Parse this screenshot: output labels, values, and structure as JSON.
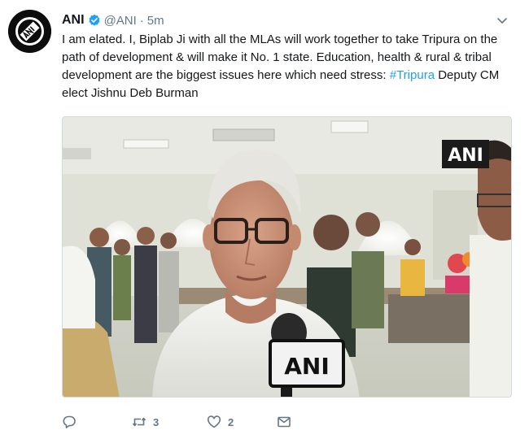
{
  "tweet": {
    "author_name": "ANI",
    "handle": "@ANI",
    "separator": "·",
    "time": "5m",
    "text_before": "I am elated. I, Biplab Ji with all the MLAs will work together to take Tripura on the path of development & will make it No. 1 state. Education, health & rural & tribal development are the biggest issues here which need stress: ",
    "hashtag": "#Tripura",
    "text_after": " Deputy CM elect Jishnu Deb Burman"
  },
  "media": {
    "watermark": "ANI",
    "mic_label": "ANI"
  },
  "actions": {
    "reply_count": "",
    "retweet_count": "3",
    "like_count": "2"
  },
  "colors": {
    "accent": "#1da1f2",
    "secondary_text": "#657786",
    "verified": "#1da1f2"
  },
  "icons": {
    "reply": "speech-bubble-icon",
    "retweet": "retweet-icon",
    "like": "heart-icon",
    "dm": "envelope-icon",
    "menu": "chevron-down-icon"
  }
}
